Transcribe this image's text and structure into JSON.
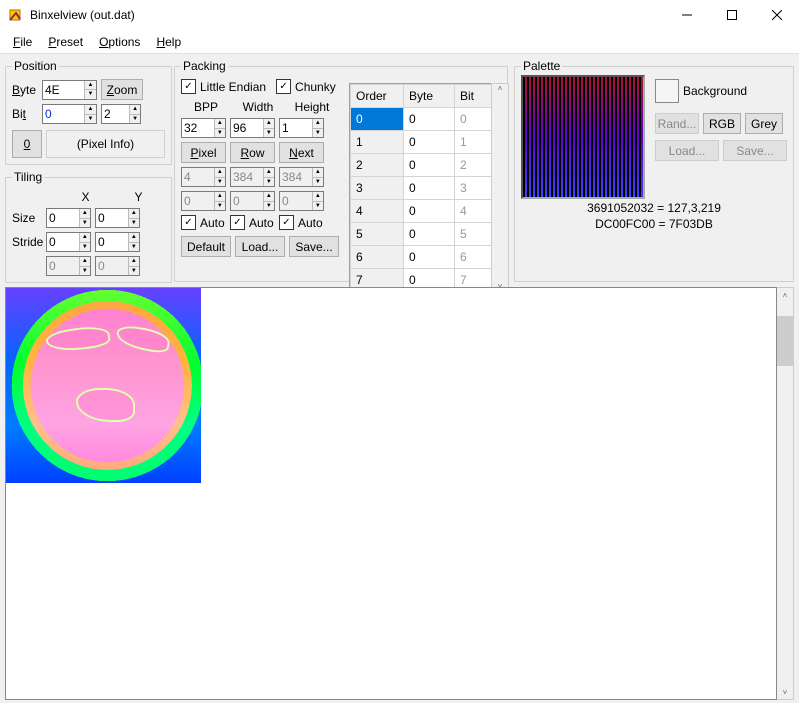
{
  "title": "Binxelview (out.dat)",
  "menu": {
    "file": "File",
    "preset": "Preset",
    "options": "Options",
    "help": "Help"
  },
  "position": {
    "legend": "Position",
    "byte_lbl": "Byte",
    "byte_val": "4E",
    "zoom": "Zoom",
    "bit_lbl": "Bit",
    "bit_val": "0",
    "bit_extra": "2",
    "zero_btn": "0",
    "pixel_info": "(Pixel Info)"
  },
  "tiling": {
    "legend": "Tiling",
    "x": "X",
    "y": "Y",
    "size_lbl": "Size",
    "stride_lbl": "Stride",
    "size_x": "0",
    "size_y": "0",
    "stride_x": "0",
    "stride_y": "0",
    "auto_x": "0",
    "auto_y": "0"
  },
  "packing": {
    "legend": "Packing",
    "little_endian": "Little Endian",
    "chunky": "Chunky",
    "bpp_lbl": "BPP",
    "width_lbl": "Width",
    "height_lbl": "Height",
    "bpp": "32",
    "width": "96",
    "height": "1",
    "pixel_btn": "Pixel",
    "row_btn": "Row",
    "next_btn": "Next",
    "pp": "4",
    "pr": "384",
    "pn": "384",
    "zp": "0",
    "zr": "0",
    "zn": "0",
    "auto": "Auto",
    "default_btn": "Default",
    "load_btn": "Load...",
    "save_btn": "Save...",
    "tbl": {
      "h_order": "Order",
      "h_byte": "Byte",
      "h_bit": "Bit",
      "rows": [
        {
          "order": "0",
          "byte": "0",
          "bit": "0"
        },
        {
          "order": "1",
          "byte": "0",
          "bit": "1"
        },
        {
          "order": "2",
          "byte": "0",
          "bit": "2"
        },
        {
          "order": "3",
          "byte": "0",
          "bit": "3"
        },
        {
          "order": "4",
          "byte": "0",
          "bit": "4"
        },
        {
          "order": "5",
          "byte": "0",
          "bit": "5"
        },
        {
          "order": "6",
          "byte": "0",
          "bit": "6"
        },
        {
          "order": "7",
          "byte": "0",
          "bit": "7"
        }
      ]
    }
  },
  "palette": {
    "legend": "Palette",
    "bg": "Background",
    "rand": "Rand...",
    "rgb": "RGB",
    "grey": "Grey",
    "load": "Load...",
    "save": "Save...",
    "line1": "3691052032 = 127,3,219",
    "line2": "DC00FC00 = 7F03DB"
  }
}
